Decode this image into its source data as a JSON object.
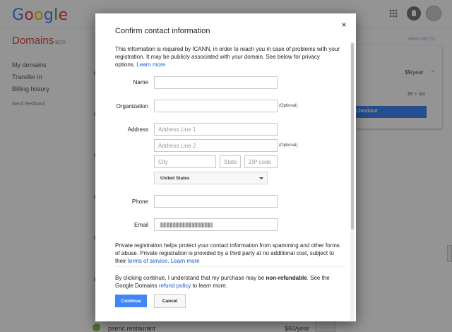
{
  "background": {
    "logo": [
      "G",
      "o",
      "o",
      "g",
      "l",
      "e"
    ],
    "brand": "Domains",
    "beta": "BETA",
    "sidebar": [
      "My domains",
      "Transfer in",
      "Billing history"
    ],
    "feedback": "Send feedback",
    "view_cart": "View cart (1)",
    "cart_price_1": "$9/year",
    "cart_close": "×",
    "cart_price_2": "$9 + tax",
    "checkout_label": "Checkout",
    "bottom_domain": "pseric.restaurant",
    "bottom_price": "$60/year",
    "colors": {
      "accent": "#4285f4",
      "brand": "#e04a3f",
      "positive": "#7cb342"
    }
  },
  "dialog": {
    "title": "Confirm contact information",
    "close_label": "×",
    "intro": {
      "text": "This information is required by ICANN, in order to reach you in case of problems with your registration. It may be publicly associated with your domain. See below for privacy options.",
      "link": "Learn more"
    },
    "form": {
      "name": {
        "label": "Name",
        "value": "",
        "placeholder": ""
      },
      "organization": {
        "label": "Organization",
        "value": "",
        "placeholder": "",
        "note": "(Optional)"
      },
      "address": {
        "label": "Address",
        "line1_placeholder": "Address Line 1",
        "line2_placeholder": "Address Line 2",
        "line2_note": "(Optional)",
        "city_placeholder": "City",
        "state_placeholder": "State",
        "zip_placeholder": "ZIP code",
        "country": "United States"
      },
      "phone": {
        "label": "Phone",
        "value": ""
      },
      "email": {
        "label": "Email"
      }
    },
    "privacy": {
      "text": "Private registration helps protect your contact information from spamming and other forms of abuse. Private registration is provided by a third party at no additional cost, subject to their",
      "terms_link": "terms of service.",
      "link": "Learn more"
    },
    "consent": {
      "text_before": "By clicking continue, I understand that my purchase may be",
      "bold": "non-refundable",
      "text_after": ". See the Google Domains",
      "link": "refund policy",
      "text_end": "to learn more."
    },
    "buttons": {
      "continue": "Continue",
      "cancel": "Cancel"
    }
  }
}
